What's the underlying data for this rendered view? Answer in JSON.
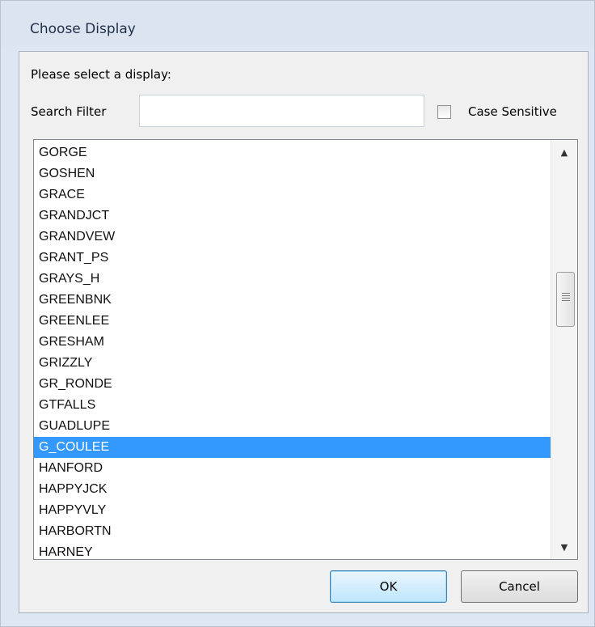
{
  "window": {
    "title": "Choose Display"
  },
  "dialog": {
    "prompt": "Please select a display:",
    "search_filter_label": "Search Filter",
    "search_filter_value": "",
    "case_sensitive_label": "Case Sensitive",
    "case_sensitive_checked": false
  },
  "list": {
    "items": [
      "GORGE",
      "GOSHEN",
      "GRACE",
      "GRANDJCT",
      "GRANDVEW",
      "GRANT_PS",
      "GRAYS_H",
      "GREENBNK",
      "GREENLEE",
      "GRESHAM",
      "GRIZZLY",
      "GR_RONDE",
      "GTFALLS",
      "GUADLUPE",
      "G_COULEE",
      "HANFORD",
      "HAPPYJCK",
      "HAPPYVLY",
      "HARBORTN",
      "HARNEY"
    ],
    "selected": "G_COULEE"
  },
  "buttons": {
    "ok": "OK",
    "cancel": "Cancel"
  },
  "colors": {
    "selection": "#3399ff",
    "title_bar": "#dbe4ef"
  },
  "icons": {
    "scroll_up": "scroll-up-arrow-icon",
    "scroll_down": "scroll-down-arrow-icon",
    "thumb_grip": "grip-icon"
  }
}
